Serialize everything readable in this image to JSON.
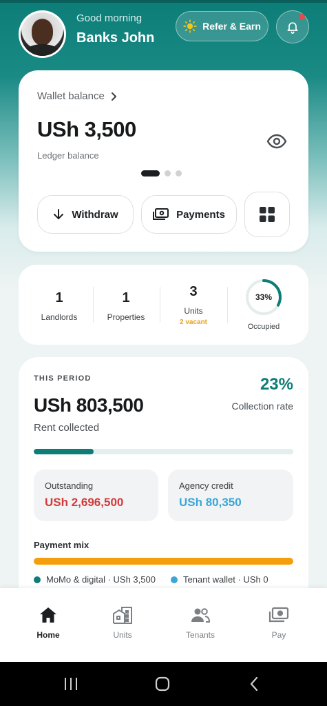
{
  "header": {
    "greeting": "Good morning",
    "user_name": "Banks John",
    "refer_label": "Refer & Earn",
    "accent_color": "#0d7d78"
  },
  "wallet": {
    "title": "Wallet balance",
    "balance": "USh 3,500",
    "ledger_label": "Ledger balance",
    "carousel_pages": 3,
    "carousel_active": 1,
    "withdraw_label": "Withdraw",
    "payments_label": "Payments"
  },
  "stats": {
    "landlords": {
      "value": "1",
      "label": "Landlords"
    },
    "properties": {
      "value": "1",
      "label": "Properties"
    },
    "units": {
      "value": "3",
      "label": "Units",
      "sub": "2 vacant"
    },
    "occupancy": {
      "percent_text": "33%",
      "percent_value": 33,
      "label": "Occupied"
    }
  },
  "period": {
    "label": "THIS PERIOD",
    "rent_collected": "USh 803,500",
    "rent_label": "Rent collected",
    "collection_rate": "23%",
    "collection_rate_value": 23,
    "collection_rate_label": "Collection rate",
    "outstanding": {
      "label": "Outstanding",
      "value": "USh 2,696,500",
      "color": "#d33b3b"
    },
    "agency_credit": {
      "label": "Agency credit",
      "value": "USh 80,350",
      "color": "#3aa6d8"
    },
    "payment_mix_label": "Payment mix",
    "legend": [
      {
        "label": "MoMo & digital · USh 3,500",
        "color": "#0d7d78"
      },
      {
        "label": "Tenant wallet · USh 0",
        "color": "#3aa6d8"
      }
    ],
    "mix_bar_color": "#f59e0b"
  },
  "nav": {
    "items": [
      {
        "label": "Home",
        "icon": "home-icon",
        "active": true
      },
      {
        "label": "Units",
        "icon": "building-icon",
        "active": false
      },
      {
        "label": "Tenants",
        "icon": "people-icon",
        "active": false
      },
      {
        "label": "Pay",
        "icon": "cash-icon",
        "active": false
      }
    ]
  }
}
